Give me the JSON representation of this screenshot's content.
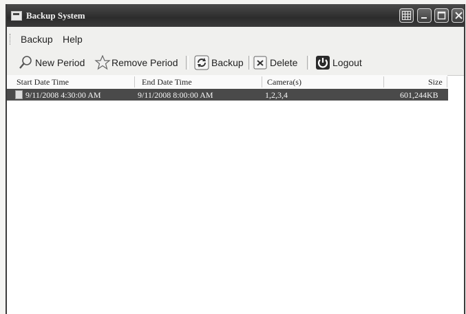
{
  "window": {
    "title": "Backup System"
  },
  "title_buttons": [
    "grid-icon",
    "minimize-icon",
    "maximize-icon",
    "close-icon"
  ],
  "menu": {
    "items": [
      {
        "label": "Backup"
      },
      {
        "label": "Help"
      }
    ]
  },
  "toolbar": {
    "new_period": "New Period",
    "remove_period": "Remove Period",
    "backup": "Backup",
    "delete": "Delete",
    "logout": "Logout"
  },
  "table": {
    "columns": [
      "Start Date Time",
      "End Date Time",
      "Camera(s)",
      "Size"
    ],
    "rows": [
      {
        "start": "9/11/2008 4:30:00 AM",
        "end": "9/11/2008 8:00:00 AM",
        "cameras": "1,2,3,4",
        "size": "601,244KB",
        "selected": true
      }
    ]
  },
  "colors": {
    "titlebar": "#2c2c2c",
    "selection": "#4a4a4a"
  }
}
